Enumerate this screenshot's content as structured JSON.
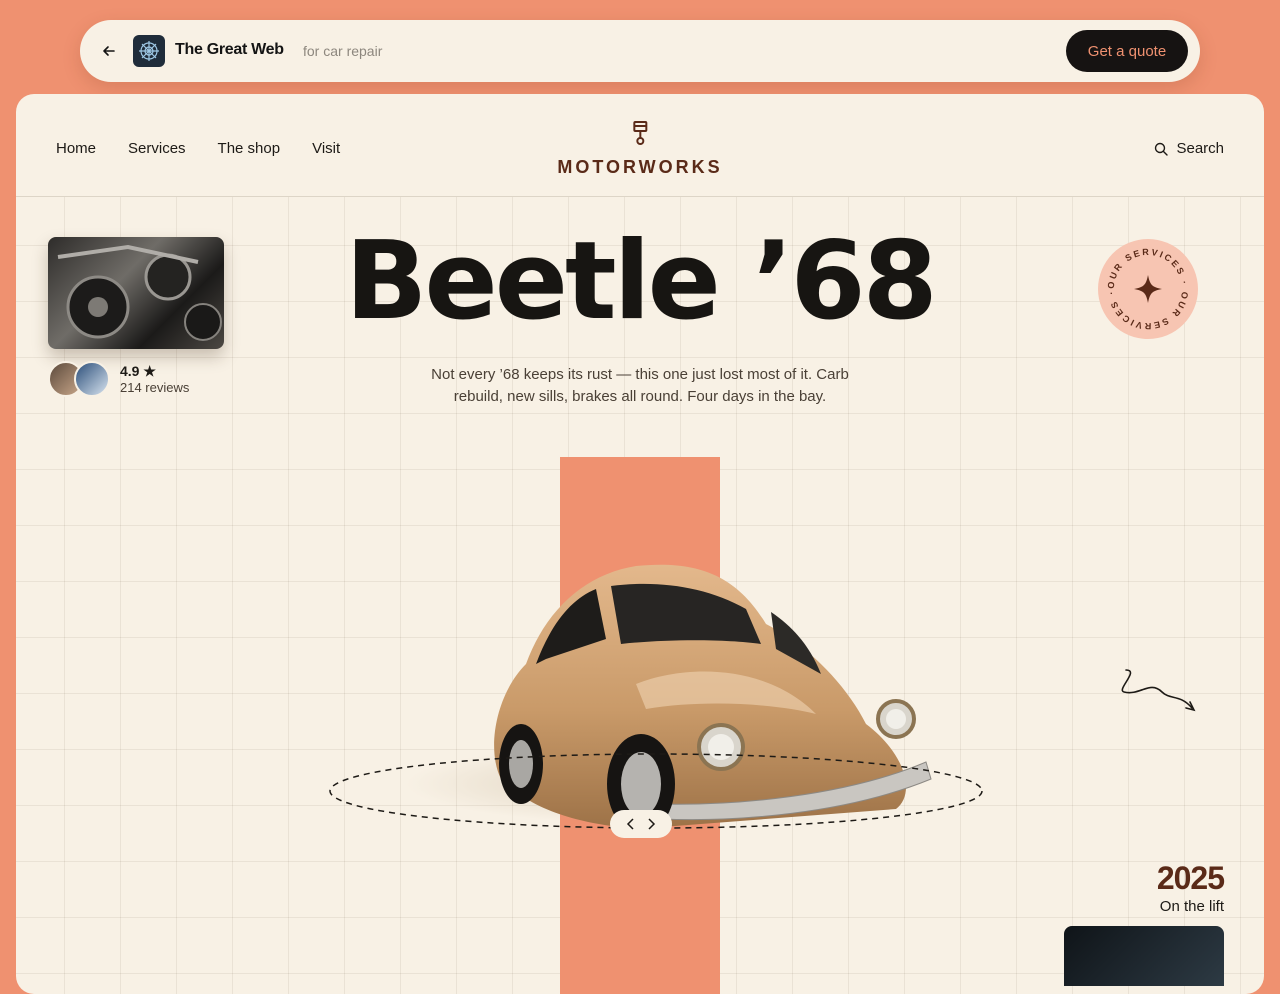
{
  "topbar": {
    "site_name": "The Great Web",
    "tagline": "for car repair",
    "cta": "Get a quote"
  },
  "nav": {
    "links": [
      "Home",
      "Services",
      "The shop",
      "Visit"
    ],
    "brand": "MOTORWORKS",
    "search_label": "Search"
  },
  "hero": {
    "title": "Beetle ’68",
    "subtitle": "Not every ’68 keeps its rust — this one just lost most of it. Carb rebuild, new sills, brakes all round. Four days in the bay."
  },
  "rating": {
    "value": "4.9",
    "count": "214 reviews"
  },
  "badge": {
    "text": "OUR SERVICES · OUR SERVICES · "
  },
  "year": {
    "value": "2025",
    "caption": "On the lift"
  },
  "colors": {
    "accent": "#ef9170",
    "dark": "#161312",
    "cream": "#f8f1e5",
    "brand": "#5a2a18"
  },
  "icons": [
    "back-arrow-icon",
    "site-logo-icon",
    "piston-icon",
    "search-icon",
    "star-icon",
    "sparkle-icon",
    "chevron-left-icon",
    "chevron-right-icon"
  ]
}
